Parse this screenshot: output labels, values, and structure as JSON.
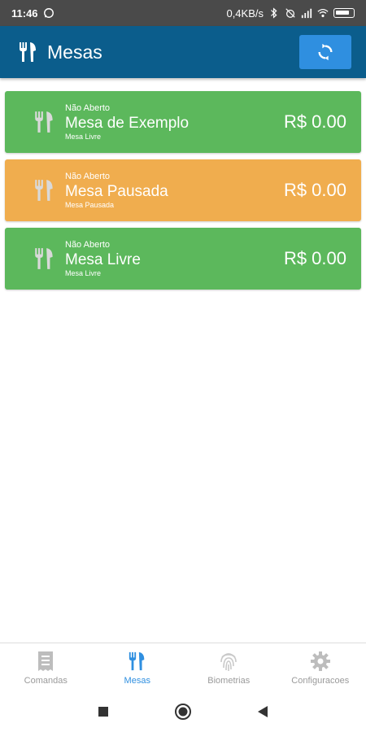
{
  "status_bar": {
    "time": "11:46",
    "network_speed": "0,4KB/s"
  },
  "app_bar": {
    "title": "Mesas",
    "icon": "cutlery-icon",
    "refresh_icon": "refresh-icon"
  },
  "tables": [
    {
      "status": "Não Aberto",
      "name": "Mesa de Exemplo",
      "sub": "Mesa Livre",
      "price": "R$ 0.00",
      "state": "free"
    },
    {
      "status": "Não Aberto",
      "name": "Mesa Pausada",
      "sub": "Mesa Pausada",
      "price": "R$ 0.00",
      "state": "paused"
    },
    {
      "status": "Não Aberto",
      "name": "Mesa Livre",
      "sub": "Mesa Livre",
      "price": "R$ 0.00",
      "state": "free"
    }
  ],
  "bottom_nav": [
    {
      "label": "Comandas",
      "icon": "receipt-icon",
      "active": false
    },
    {
      "label": "Mesas",
      "icon": "cutlery-icon",
      "active": true
    },
    {
      "label": "Biometrias",
      "icon": "fingerprint-icon",
      "active": false
    },
    {
      "label": "Configuracoes",
      "icon": "gear-icon",
      "active": false
    }
  ],
  "colors": {
    "app_bar": "#0b5d8c",
    "refresh_button": "#2f8fe0",
    "table_free": "#5cb85c",
    "table_paused": "#f0ad4e",
    "nav_active": "#2f8fe0",
    "nav_inactive": "#9a9a9a"
  }
}
